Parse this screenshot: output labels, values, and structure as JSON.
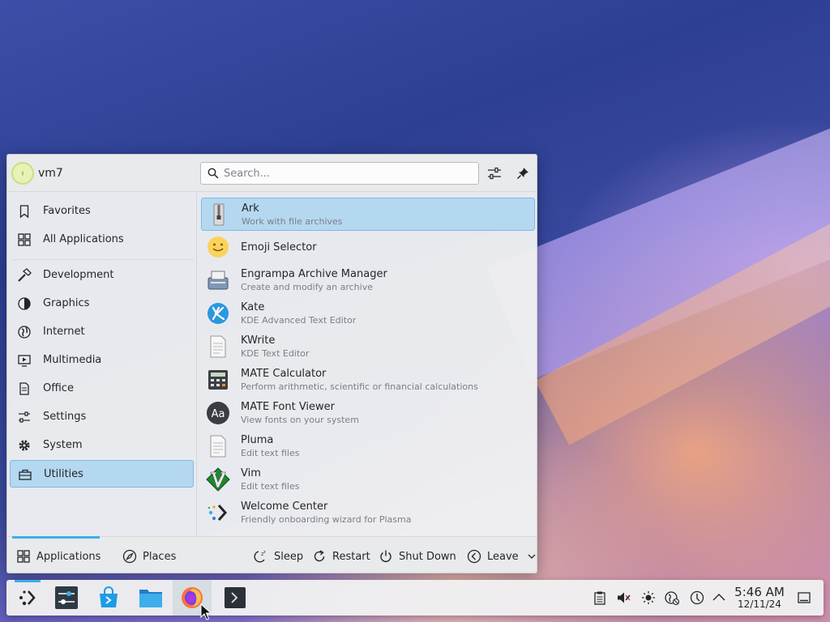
{
  "user": {
    "name": "vm7"
  },
  "search": {
    "placeholder": "Search..."
  },
  "sidebar": {
    "items": [
      {
        "label": "Favorites",
        "icon": "bookmark-icon"
      },
      {
        "label": "All Applications",
        "icon": "grid-icon"
      },
      {
        "label": "Development",
        "icon": "hammer-icon"
      },
      {
        "label": "Graphics",
        "icon": "graphics-icon"
      },
      {
        "label": "Internet",
        "icon": "globe-icon"
      },
      {
        "label": "Multimedia",
        "icon": "multimedia-icon"
      },
      {
        "label": "Office",
        "icon": "document-icon"
      },
      {
        "label": "Settings",
        "icon": "sliders-icon"
      },
      {
        "label": "System",
        "icon": "gear-icon"
      },
      {
        "label": "Utilities",
        "icon": "toolbox-icon"
      }
    ],
    "selected": "Utilities"
  },
  "apps": [
    {
      "name": "Ark",
      "desc": "Work with file archives"
    },
    {
      "name": "Emoji Selector",
      "desc": ""
    },
    {
      "name": "Engrampa Archive Manager",
      "desc": "Create and modify an archive"
    },
    {
      "name": "Kate",
      "desc": "KDE Advanced Text Editor"
    },
    {
      "name": "KWrite",
      "desc": "KDE Text Editor"
    },
    {
      "name": "MATE Calculator",
      "desc": "Perform arithmetic, scientific or financial calculations"
    },
    {
      "name": "MATE Font Viewer",
      "desc": "View fonts on your system"
    },
    {
      "name": "Pluma",
      "desc": "Edit text files"
    },
    {
      "name": "Vim",
      "desc": "Edit text files"
    },
    {
      "name": "Welcome Center",
      "desc": "Friendly onboarding wizard for Plasma"
    }
  ],
  "font_viewer_glyph": "Aa",
  "footer": {
    "applications": "Applications",
    "places": "Places",
    "sleep": "Sleep",
    "restart": "Restart",
    "shutdown": "Shut Down",
    "leave": "Leave"
  },
  "clock": {
    "time": "5:46 AM",
    "date": "12/11/24"
  },
  "colors": {
    "accent": "#3daee9",
    "selection": "#b5d8f1"
  }
}
